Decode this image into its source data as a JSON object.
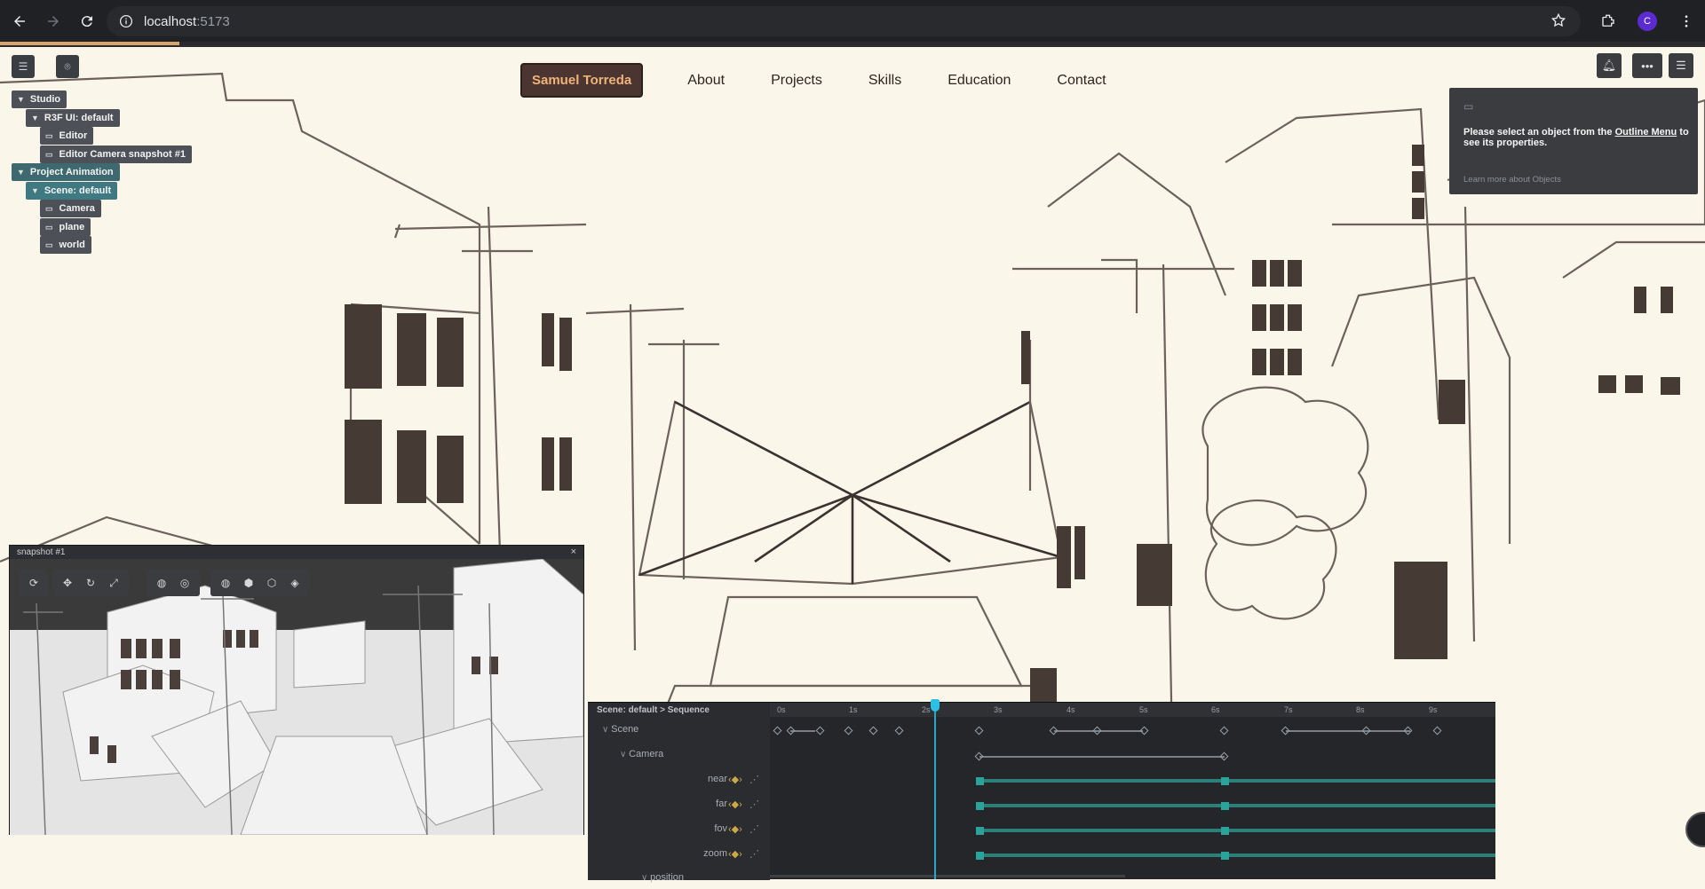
{
  "browser": {
    "url_host": "localhost",
    "url_port": ":5173",
    "avatar_letter": "C"
  },
  "site": {
    "brand": "Samuel Torreda",
    "nav": [
      "About",
      "Projects",
      "Skills",
      "Education",
      "Contact"
    ]
  },
  "outline": {
    "items": [
      {
        "label": "Studio",
        "type": "group"
      },
      {
        "label": "R3F UI: default",
        "type": "group"
      },
      {
        "label": "Editor",
        "type": "object"
      },
      {
        "label": "Editor Camera snapshot #1",
        "type": "object"
      },
      {
        "label": "Project Animation",
        "type": "group"
      },
      {
        "label": "Scene: default",
        "type": "group"
      },
      {
        "label": "Camera",
        "type": "object"
      },
      {
        "label": "plane",
        "type": "object"
      },
      {
        "label": "world",
        "type": "object"
      }
    ]
  },
  "properties": {
    "message_pre": "Please select an object from the ",
    "message_link": "Outline Menu",
    "message_post": " to see its properties.",
    "learn_more": "Learn more about Objects"
  },
  "snapshot": {
    "title": "snapshot #1",
    "close": "×"
  },
  "sequence": {
    "breadcrumb": "Scene: default > Sequence",
    "ruler": [
      "0s",
      "1s",
      "2s",
      "3s",
      "4s",
      "5s",
      "6s",
      "7s",
      "8s",
      "9s"
    ],
    "tracks": {
      "scene": "Scene",
      "camera": "Camera",
      "props": [
        "near",
        "far",
        "fov",
        "zoom"
      ],
      "position": "position"
    }
  },
  "colors": {
    "brand_bg": "#4a3530",
    "brand_text": "#f0b37a",
    "page_bg": "#fbf6ea",
    "track_bar": "#2d8077",
    "playhead": "#2ba6c7"
  }
}
